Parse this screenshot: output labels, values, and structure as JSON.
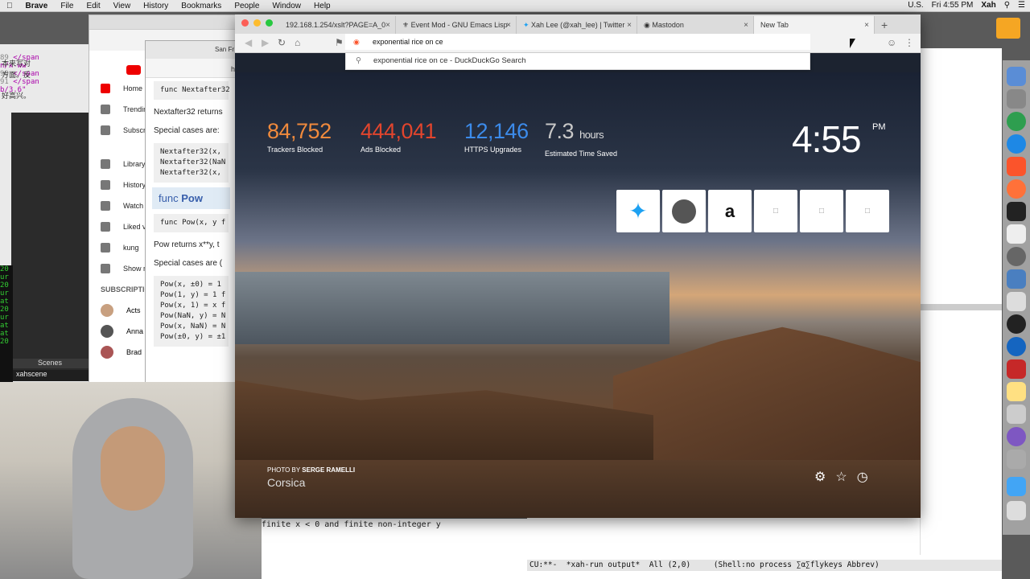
{
  "menubar": {
    "app": "Brave",
    "items": [
      "File",
      "Edit",
      "View",
      "History",
      "Bookmarks",
      "People",
      "Window",
      "Help"
    ],
    "right": {
      "keyboard": "U.S.",
      "clock": "Fri 4:55 PM",
      "user": "Xah"
    }
  },
  "left_code": {
    "lines": [
      {
        "n": "89",
        "t": "</span"
      },
      {
        "n": "",
        "t": "n/x-ww"
      },
      {
        "n": "90",
        "t": "</span"
      },
      {
        "n": "91",
        "t": "</span"
      },
      {
        "n": "",
        "t": "b/3.6\""
      }
    ],
    "cjk1": "本来写对",
    "cjk2": "方面。反",
    "cjk3": "好高兴。"
  },
  "obs": {
    "scenes_label": "Scenes",
    "scene_item": "xahscene"
  },
  "youtube": {
    "items": [
      {
        "label": "Home",
        "active": true
      },
      {
        "label": "Trending"
      },
      {
        "label": "Subscriptions"
      },
      {
        "label": "Library"
      },
      {
        "label": "History"
      },
      {
        "label": "Watch later"
      },
      {
        "label": "Liked videos"
      },
      {
        "label": "kung"
      },
      {
        "label": "Show more"
      }
    ],
    "subs_header": "SUBSCRIPTIONS",
    "subs": [
      "Acts",
      "Anna",
      "Brad"
    ]
  },
  "godoc": {
    "tab_label": "San Fr",
    "addr_hint": "htt",
    "code1": "func Nextafter32",
    "p1": "Nextafter32 returns",
    "p2": "Special cases are:",
    "code2": [
      "Nextafter32(x,",
      "Nextafter32(NaN",
      "Nextafter32(x,"
    ],
    "func_heading_prefix": "func",
    "func_heading_name": "Pow",
    "code3": "func Pow(x, y f",
    "p3": "Pow returns x**y, t",
    "p4": "Special cases are (",
    "code4": [
      "Pow(x, ±0) = 1",
      "Pow(1, y) = 1 f",
      "Pow(x, 1) = x f",
      "Pow(NaN, y) = N",
      "Pow(x, NaN) = N",
      "Pow(±0, y) = ±1"
    ]
  },
  "emacs": {
    "line": "finite x < 0 and finite non-integer y",
    "modeline": "CU:**-  *xah-run output*  All (2,0)     (Shell:no process ∑α∑flykeys Abbrev)"
  },
  "brave": {
    "tabs": [
      {
        "label": "192.168.1.254/xslt?PAGE=A_0"
      },
      {
        "label": "Event Mod - GNU Emacs Lisp"
      },
      {
        "label": "Xah Lee (@xah_lee) | Twitter"
      },
      {
        "label": "Mastodon"
      },
      {
        "label": "New Tab",
        "active": true
      }
    ],
    "omnibox_value": "exponential rice on ce",
    "suggestion": "exponential rice on ce - DuckDuckGo Search",
    "stats": [
      {
        "value": "84,752",
        "unit": "",
        "label": "Trackers Blocked",
        "color": "#f08a3c"
      },
      {
        "value": "444,041",
        "unit": "",
        "label": "Ads Blocked",
        "color": "#e2452d"
      },
      {
        "value": "12,146",
        "unit": "",
        "label": "HTTPS Upgrades",
        "color": "#3c8bea"
      },
      {
        "value": "7.3",
        "unit": "hours",
        "label": "Estimated Time Saved",
        "color": "#c8c8c8"
      }
    ],
    "clock": "4:55",
    "ampm": "PM",
    "tiles": [
      "twitter-icon",
      "mastodon-icon",
      "amazon-icon",
      "page-icon",
      "page-icon",
      "page-icon"
    ],
    "photo_by_prefix": "PHOTO BY",
    "photographer": "SERGE RAMELLI",
    "location": "Corsica"
  }
}
